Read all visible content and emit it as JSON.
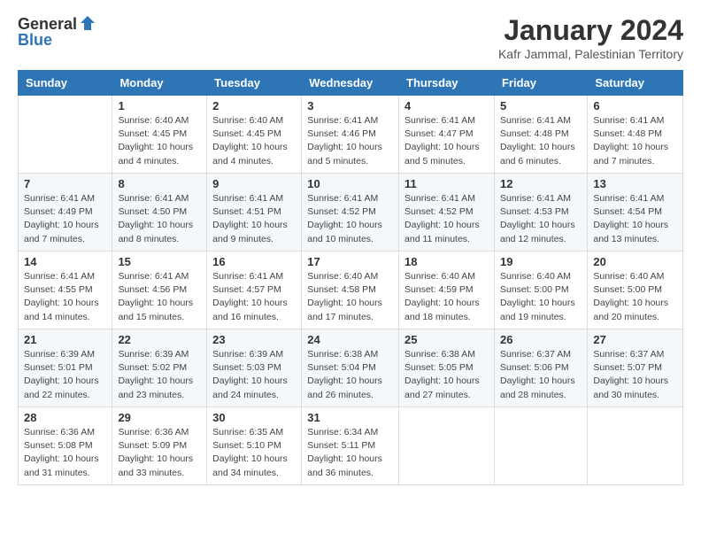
{
  "header": {
    "logo_general": "General",
    "logo_blue": "Blue",
    "month_title": "January 2024",
    "location": "Kafr Jammal, Palestinian Territory"
  },
  "days_of_week": [
    "Sunday",
    "Monday",
    "Tuesday",
    "Wednesday",
    "Thursday",
    "Friday",
    "Saturday"
  ],
  "weeks": [
    [
      {
        "day": "",
        "info": ""
      },
      {
        "day": "1",
        "info": "Sunrise: 6:40 AM\nSunset: 4:45 PM\nDaylight: 10 hours\nand 4 minutes."
      },
      {
        "day": "2",
        "info": "Sunrise: 6:40 AM\nSunset: 4:45 PM\nDaylight: 10 hours\nand 4 minutes."
      },
      {
        "day": "3",
        "info": "Sunrise: 6:41 AM\nSunset: 4:46 PM\nDaylight: 10 hours\nand 5 minutes."
      },
      {
        "day": "4",
        "info": "Sunrise: 6:41 AM\nSunset: 4:47 PM\nDaylight: 10 hours\nand 5 minutes."
      },
      {
        "day": "5",
        "info": "Sunrise: 6:41 AM\nSunset: 4:48 PM\nDaylight: 10 hours\nand 6 minutes."
      },
      {
        "day": "6",
        "info": "Sunrise: 6:41 AM\nSunset: 4:48 PM\nDaylight: 10 hours\nand 7 minutes."
      }
    ],
    [
      {
        "day": "7",
        "info": "Sunrise: 6:41 AM\nSunset: 4:49 PM\nDaylight: 10 hours\nand 7 minutes."
      },
      {
        "day": "8",
        "info": "Sunrise: 6:41 AM\nSunset: 4:50 PM\nDaylight: 10 hours\nand 8 minutes."
      },
      {
        "day": "9",
        "info": "Sunrise: 6:41 AM\nSunset: 4:51 PM\nDaylight: 10 hours\nand 9 minutes."
      },
      {
        "day": "10",
        "info": "Sunrise: 6:41 AM\nSunset: 4:52 PM\nDaylight: 10 hours\nand 10 minutes."
      },
      {
        "day": "11",
        "info": "Sunrise: 6:41 AM\nSunset: 4:52 PM\nDaylight: 10 hours\nand 11 minutes."
      },
      {
        "day": "12",
        "info": "Sunrise: 6:41 AM\nSunset: 4:53 PM\nDaylight: 10 hours\nand 12 minutes."
      },
      {
        "day": "13",
        "info": "Sunrise: 6:41 AM\nSunset: 4:54 PM\nDaylight: 10 hours\nand 13 minutes."
      }
    ],
    [
      {
        "day": "14",
        "info": "Sunrise: 6:41 AM\nSunset: 4:55 PM\nDaylight: 10 hours\nand 14 minutes."
      },
      {
        "day": "15",
        "info": "Sunrise: 6:41 AM\nSunset: 4:56 PM\nDaylight: 10 hours\nand 15 minutes."
      },
      {
        "day": "16",
        "info": "Sunrise: 6:41 AM\nSunset: 4:57 PM\nDaylight: 10 hours\nand 16 minutes."
      },
      {
        "day": "17",
        "info": "Sunrise: 6:40 AM\nSunset: 4:58 PM\nDaylight: 10 hours\nand 17 minutes."
      },
      {
        "day": "18",
        "info": "Sunrise: 6:40 AM\nSunset: 4:59 PM\nDaylight: 10 hours\nand 18 minutes."
      },
      {
        "day": "19",
        "info": "Sunrise: 6:40 AM\nSunset: 5:00 PM\nDaylight: 10 hours\nand 19 minutes."
      },
      {
        "day": "20",
        "info": "Sunrise: 6:40 AM\nSunset: 5:00 PM\nDaylight: 10 hours\nand 20 minutes."
      }
    ],
    [
      {
        "day": "21",
        "info": "Sunrise: 6:39 AM\nSunset: 5:01 PM\nDaylight: 10 hours\nand 22 minutes."
      },
      {
        "day": "22",
        "info": "Sunrise: 6:39 AM\nSunset: 5:02 PM\nDaylight: 10 hours\nand 23 minutes."
      },
      {
        "day": "23",
        "info": "Sunrise: 6:39 AM\nSunset: 5:03 PM\nDaylight: 10 hours\nand 24 minutes."
      },
      {
        "day": "24",
        "info": "Sunrise: 6:38 AM\nSunset: 5:04 PM\nDaylight: 10 hours\nand 26 minutes."
      },
      {
        "day": "25",
        "info": "Sunrise: 6:38 AM\nSunset: 5:05 PM\nDaylight: 10 hours\nand 27 minutes."
      },
      {
        "day": "26",
        "info": "Sunrise: 6:37 AM\nSunset: 5:06 PM\nDaylight: 10 hours\nand 28 minutes."
      },
      {
        "day": "27",
        "info": "Sunrise: 6:37 AM\nSunset: 5:07 PM\nDaylight: 10 hours\nand 30 minutes."
      }
    ],
    [
      {
        "day": "28",
        "info": "Sunrise: 6:36 AM\nSunset: 5:08 PM\nDaylight: 10 hours\nand 31 minutes."
      },
      {
        "day": "29",
        "info": "Sunrise: 6:36 AM\nSunset: 5:09 PM\nDaylight: 10 hours\nand 33 minutes."
      },
      {
        "day": "30",
        "info": "Sunrise: 6:35 AM\nSunset: 5:10 PM\nDaylight: 10 hours\nand 34 minutes."
      },
      {
        "day": "31",
        "info": "Sunrise: 6:34 AM\nSunset: 5:11 PM\nDaylight: 10 hours\nand 36 minutes."
      },
      {
        "day": "",
        "info": ""
      },
      {
        "day": "",
        "info": ""
      },
      {
        "day": "",
        "info": ""
      }
    ]
  ]
}
